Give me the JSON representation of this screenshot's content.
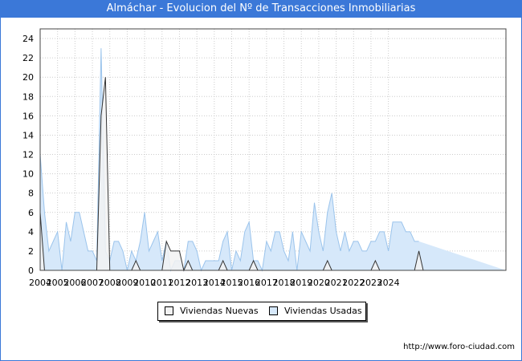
{
  "title": "Almáchar - Evolucion del Nº de Transacciones Inmobiliarias",
  "footer_url": "http://www.foro-ciudad.com",
  "chart_data": {
    "type": "area",
    "title": "Almáchar - Evolucion del Nº de Transacciones Inmobiliarias",
    "xlabel": "",
    "ylabel": "",
    "x_start": "2004 Q1",
    "x_end": "2024 Q4",
    "quarters_per_year": 4,
    "ylim": [
      0,
      25
    ],
    "yticks": [
      0,
      2,
      4,
      6,
      8,
      10,
      12,
      14,
      16,
      18,
      20,
      22,
      24
    ],
    "xticks": [
      "2004",
      "2005",
      "2006",
      "2007",
      "2008",
      "2009",
      "2010",
      "2011",
      "2012",
      "2013",
      "2014",
      "2015",
      "2016",
      "2017",
      "2018",
      "2019",
      "2020",
      "2021",
      "2022",
      "2023",
      "2024"
    ],
    "grid": true,
    "legend_position": "bottom-center",
    "series": [
      {
        "name": "Viviendas Nuevas",
        "color": "#f2f2f2",
        "stroke": "#333333",
        "values": [
          6,
          0,
          0,
          0,
          0,
          0,
          0,
          0,
          0,
          0,
          0,
          0,
          0,
          0,
          16,
          20,
          0,
          0,
          0,
          0,
          0,
          0,
          1,
          0,
          0,
          0,
          0,
          0,
          0,
          3,
          2,
          2,
          2,
          0,
          1,
          0,
          0,
          0,
          0,
          0,
          0,
          0,
          1,
          0,
          0,
          0,
          0,
          0,
          0,
          1,
          0,
          0,
          0,
          0,
          0,
          0,
          0,
          0,
          0,
          0,
          0,
          0,
          0,
          0,
          0,
          0,
          1,
          0,
          0,
          0,
          0,
          0,
          0,
          0,
          0,
          0,
          0,
          1,
          0,
          0,
          0,
          0,
          0,
          0,
          0,
          0,
          0,
          2,
          0,
          0,
          0,
          0,
          0,
          0,
          0,
          0,
          0,
          0,
          0,
          0,
          0,
          0,
          0,
          0,
          0,
          0,
          0,
          0
        ]
      },
      {
        "name": "Viviendas Usadas",
        "color": "#d6e8fa",
        "stroke": "#9bc4ec",
        "values": [
          12,
          6,
          2,
          3,
          4,
          0,
          5,
          3,
          6,
          6,
          4,
          2,
          2,
          1,
          23,
          2,
          1,
          3,
          3,
          2,
          0,
          2,
          1,
          3,
          6,
          2,
          3,
          4,
          1,
          3,
          0,
          1,
          1,
          0,
          3,
          3,
          2,
          0,
          1,
          1,
          1,
          1,
          3,
          4,
          0,
          2,
          1,
          4,
          5,
          1,
          1,
          0,
          3,
          2,
          4,
          4,
          2,
          1,
          4,
          0,
          4,
          3,
          2,
          7,
          4,
          2,
          6,
          8,
          4,
          2,
          4,
          2,
          3,
          3,
          2,
          2,
          3,
          3,
          4,
          4,
          2,
          5,
          5,
          5,
          4,
          4,
          3,
          3
        ]
      }
    ]
  }
}
